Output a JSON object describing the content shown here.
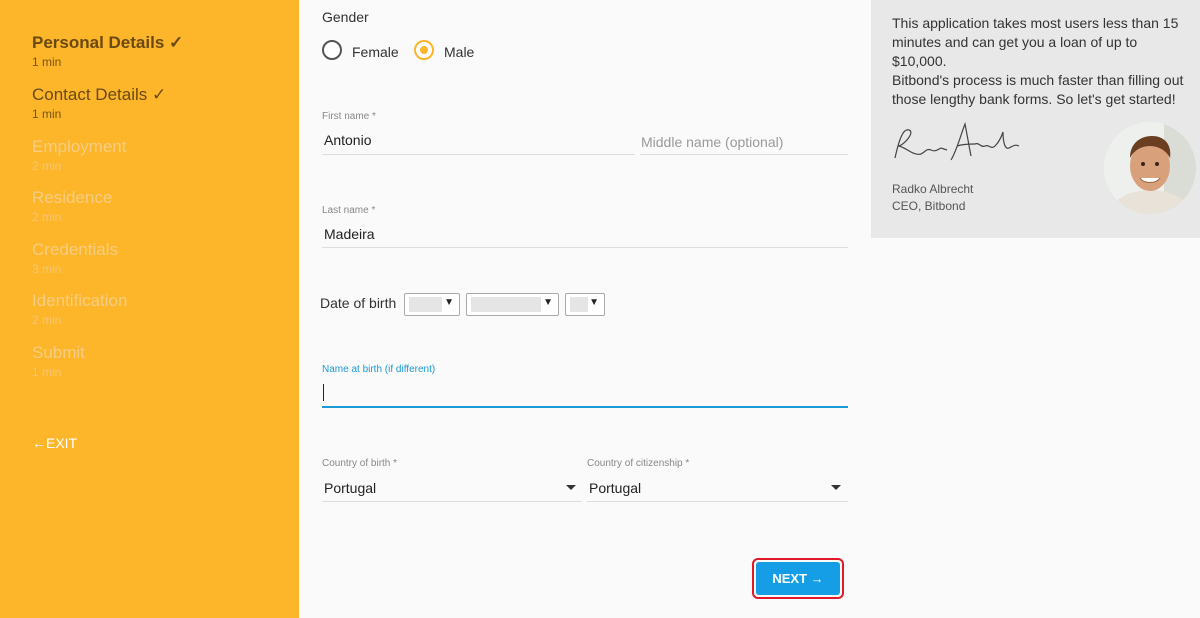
{
  "sidebar": {
    "steps": [
      {
        "title": "Personal Details ✓",
        "time": "1 min"
      },
      {
        "title": "Contact Details ✓",
        "time": "1 min"
      },
      {
        "title": "Employment",
        "time": "2 min"
      },
      {
        "title": "Residence",
        "time": "2 min"
      },
      {
        "title": "Credentials",
        "time": "3 min"
      },
      {
        "title": "Identification",
        "time": "2 min"
      },
      {
        "title": "Submit",
        "time": "1 min"
      }
    ],
    "exit_label": "←EXIT"
  },
  "form": {
    "gender": {
      "label": "Gender",
      "options": [
        "Female",
        "Male"
      ],
      "selected": "Male"
    },
    "first_name": {
      "label": "First name",
      "required_mark": "*",
      "value": "Antonio"
    },
    "middle_name": {
      "placeholder": "Middle name (optional)"
    },
    "last_name": {
      "label": "Last name",
      "required_mark": "*",
      "value": "Madeira"
    },
    "dob": {
      "label": "Date of birth",
      "caret": "▼"
    },
    "name_at_birth": {
      "label": "Name at birth (if different)",
      "value": ""
    },
    "country_of_birth": {
      "label": "Country of birth",
      "required_mark": "*",
      "value": "Portugal"
    },
    "country_of_citizenship": {
      "label": "Country of citizenship",
      "required_mark": "*",
      "value": "Portugal"
    },
    "next_label": "NEXT →"
  },
  "info": {
    "text_line1": "This application takes most users less than 15 minutes and can get you a loan of up to $10,000.",
    "text_line2": "Bitbond's process is much faster than filling out those lengthy bank forms. So let's get started!",
    "person_name": "Radko Albrecht",
    "person_role": "CEO, Bitbond"
  },
  "colors": {
    "sidebar_bg": "#fdb52a",
    "accent_blue": "#159ee6",
    "focus_blue": "#1a9ad6",
    "highlight_red": "#e0192b"
  }
}
